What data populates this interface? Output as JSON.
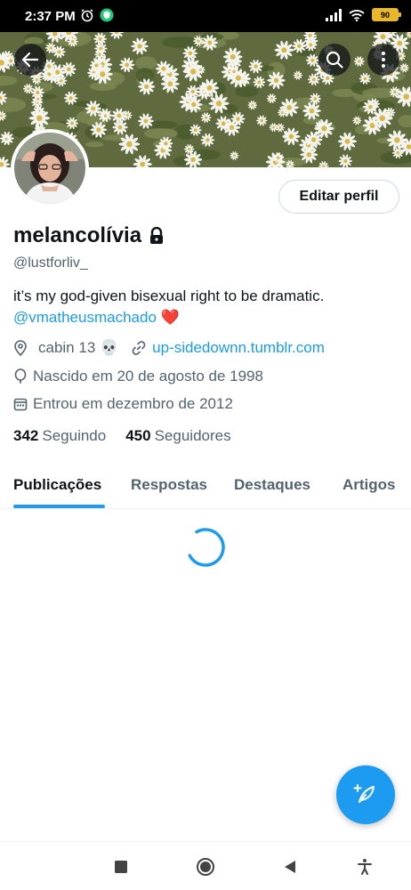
{
  "status_bar": {
    "time": "2:37 PM",
    "battery": "90"
  },
  "header": {
    "icons": [
      "back-arrow-icon",
      "search-icon",
      "more-vertical-icon"
    ]
  },
  "profile": {
    "edit_label": "Editar perfil",
    "name": "melancolívia",
    "handle": "@lustforliv_",
    "bio_text": "it’s my god-given bisexual right to be dramatic.",
    "bio_mention": "@vmatheusmachado",
    "bio_emoji": "❤️",
    "location": "cabin 13 💀",
    "website": "up-sidedownn.tumblr.com",
    "birth": "Nascido em 20 de agosto de 1998",
    "joined": "Entrou em dezembro de 2012",
    "following_count": "342",
    "following_label": "Seguindo",
    "followers_count": "450",
    "followers_label": "Seguidores"
  },
  "tabs": [
    {
      "label": "Publicações",
      "active": true
    },
    {
      "label": "Respostas",
      "active": false
    },
    {
      "label": "Destaques",
      "active": false
    },
    {
      "label": "Artigos",
      "active": false
    }
  ],
  "colors": {
    "accent": "#1d9bf0",
    "text": "#0f1419",
    "muted": "#536471"
  }
}
